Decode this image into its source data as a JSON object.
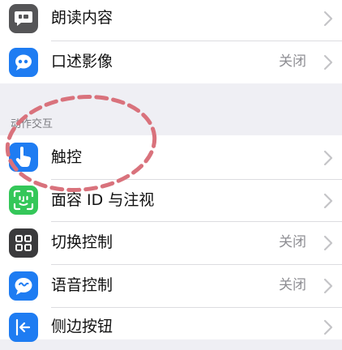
{
  "section_top": {
    "items": [
      {
        "label": "朗读内容",
        "value": "",
        "icon": "speech-bubble-icon",
        "color": "#555557"
      },
      {
        "label": "口述影像",
        "value": "关闭",
        "icon": "quote-bubble-icon",
        "color": "#1e7cf2"
      }
    ]
  },
  "section_interaction": {
    "header": "动作交互",
    "items": [
      {
        "label": "触控",
        "value": "",
        "icon": "hand-point-icon",
        "color": "#1e7cf2"
      },
      {
        "label": "面容 ID 与注视",
        "value": "",
        "icon": "face-id-icon",
        "color": "#34c759"
      },
      {
        "label": "切换控制",
        "value": "关闭",
        "icon": "grid-icon",
        "color": "#3a3a3c"
      },
      {
        "label": "语音控制",
        "value": "关闭",
        "icon": "voice-control-icon",
        "color": "#1e7cf2"
      },
      {
        "label": "侧边按钮",
        "value": "",
        "icon": "side-button-icon",
        "color": "#1e7cf2"
      }
    ]
  },
  "colors": {
    "annotation": "#d9727c",
    "background": "#efeff4"
  }
}
